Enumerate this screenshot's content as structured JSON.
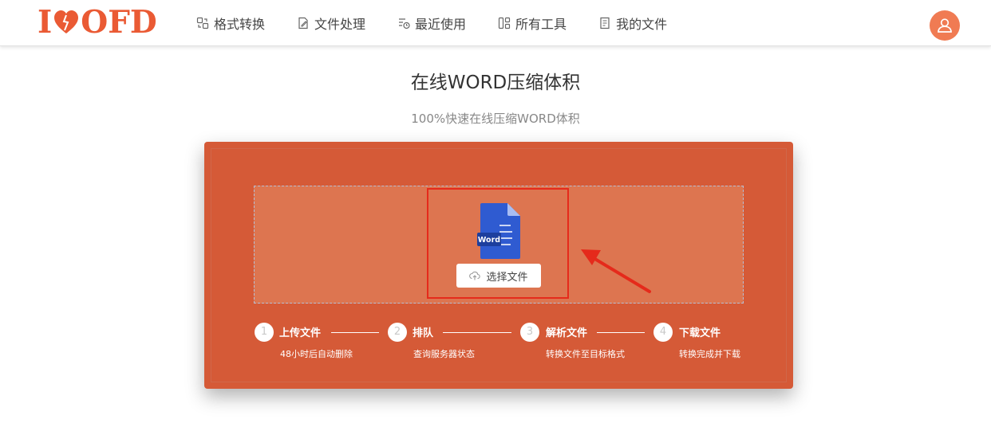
{
  "logo": {
    "prefix": "I",
    "suffix": "OFD"
  },
  "nav": [
    {
      "label": "格式转换",
      "icon": "format-convert-icon"
    },
    {
      "label": "文件处理",
      "icon": "file-edit-icon"
    },
    {
      "label": "最近使用",
      "icon": "recent-history-icon"
    },
    {
      "label": "所有工具",
      "icon": "grid-tools-icon"
    },
    {
      "label": "我的文件",
      "icon": "my-files-icon"
    }
  ],
  "page": {
    "title": "在线WORD压缩体积",
    "subtitle": "100%快速在线压缩WORD体积"
  },
  "upload": {
    "file_type_label": "Word",
    "button_label": "选择文件"
  },
  "steps": [
    {
      "num": "1",
      "title": "上传文件",
      "desc": "48小时后自动删除"
    },
    {
      "num": "2",
      "title": "排队",
      "desc": "查询服务器状态"
    },
    {
      "num": "3",
      "title": "解析文件",
      "desc": "转换文件至目标格式"
    },
    {
      "num": "4",
      "title": "下载文件",
      "desc": "转换完成并下载"
    }
  ],
  "colors": {
    "brand": "#ea5a34",
    "panel": "#d55a37",
    "dropzone": "#dd7550",
    "highlight": "#e52a1b",
    "word_blue": "#2f5bd1"
  }
}
